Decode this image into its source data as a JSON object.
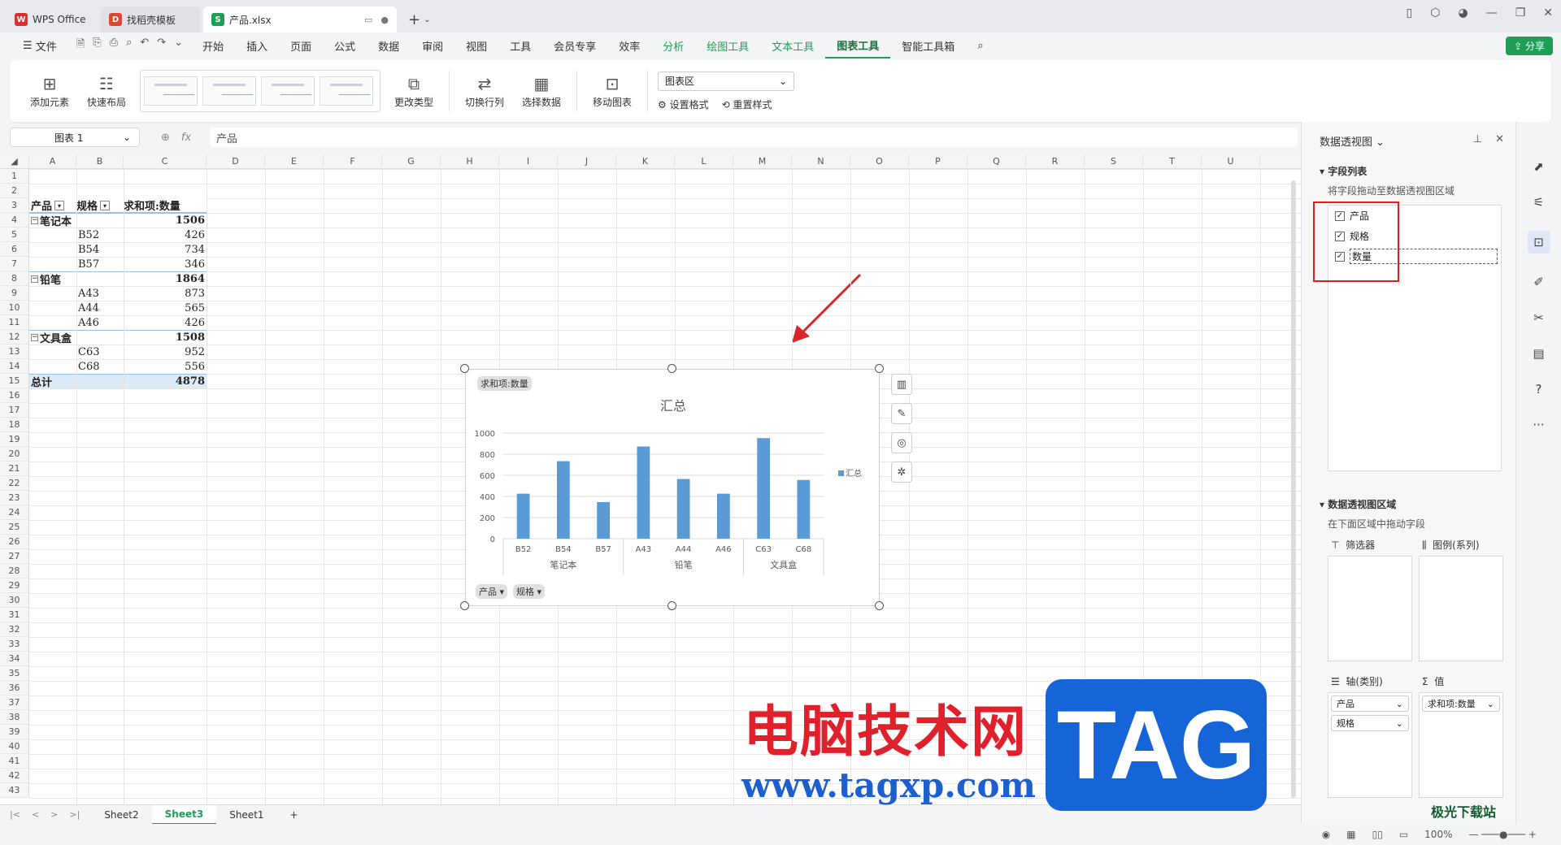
{
  "titlebar": {
    "tabs": [
      {
        "label": "WPS Office",
        "icon": "wps-logo-icon"
      },
      {
        "label": "找稻壳模板",
        "icon": "docer-icon"
      },
      {
        "label": "产品.xlsx",
        "icon": "spreadsheet-icon"
      }
    ]
  },
  "menubar": {
    "file": "文件",
    "items": [
      "开始",
      "插入",
      "页面",
      "公式",
      "数据",
      "审阅",
      "视图",
      "工具",
      "会员专享",
      "效率"
    ],
    "context_items": [
      "分析",
      "绘图工具",
      "文本工具",
      "图表工具"
    ],
    "smart": "智能工具箱",
    "share": "分享"
  },
  "ribbon": {
    "add_element": "添加元素",
    "quick_layout": "快速布局",
    "change_type": "更改类型",
    "switch_rowcol": "切换行列",
    "select_data": "选择数据",
    "move_chart": "移动图表",
    "chart_area_select": "图表区",
    "set_format": "设置格式",
    "reset_style": "重置样式"
  },
  "formula": {
    "namebox": "图表 1",
    "fx": "fx",
    "content": "产品"
  },
  "sheet": {
    "columns": [
      "A",
      "B",
      "C",
      "D",
      "E",
      "F",
      "G",
      "H",
      "I",
      "J",
      "K",
      "L",
      "M",
      "N",
      "O",
      "P",
      "Q",
      "R",
      "S",
      "T",
      "U"
    ],
    "rows": [
      "1",
      "2",
      "3",
      "4",
      "5",
      "6",
      "7",
      "8",
      "9",
      "10",
      "11",
      "12",
      "13",
      "14",
      "15",
      "16",
      "17",
      "18",
      "19",
      "20",
      "21",
      "22",
      "23",
      "24",
      "25",
      "26",
      "27",
      "28",
      "29",
      "30",
      "31",
      "32",
      "33",
      "34",
      "35",
      "36",
      "37",
      "38",
      "39",
      "40",
      "41",
      "42",
      "43"
    ]
  },
  "pivot": {
    "header": {
      "product": "产品",
      "spec": "规格",
      "sum": "求和项:数量"
    },
    "groups": [
      {
        "name": "笔记本",
        "total": "1506",
        "items": [
          {
            "spec": "B52",
            "qty": "426"
          },
          {
            "spec": "B54",
            "qty": "734"
          },
          {
            "spec": "B57",
            "qty": "346"
          }
        ]
      },
      {
        "name": "铅笔",
        "total": "1864",
        "items": [
          {
            "spec": "A43",
            "qty": "873"
          },
          {
            "spec": "A44",
            "qty": "565"
          },
          {
            "spec": "A46",
            "qty": "426"
          }
        ]
      },
      {
        "name": "文具盒",
        "total": "1508",
        "items": [
          {
            "spec": "C63",
            "qty": "952"
          },
          {
            "spec": "C68",
            "qty": "556"
          }
        ]
      }
    ],
    "grand_total_label": "总计",
    "grand_total": "4878"
  },
  "chart_data": {
    "type": "bar",
    "title": "汇总",
    "categories": [
      "B52",
      "B54",
      "B57",
      "A43",
      "A44",
      "A46",
      "C63",
      "C68"
    ],
    "groups": [
      {
        "name": "笔记本",
        "span": 3
      },
      {
        "name": "铅笔",
        "span": 3
      },
      {
        "name": "文具盒",
        "span": 2
      }
    ],
    "series": [
      {
        "name": "汇总",
        "values": [
          426,
          734,
          346,
          873,
          565,
          426,
          952,
          556
        ],
        "color": "#5b9bd5"
      }
    ],
    "ylim": [
      0,
      1000
    ],
    "yticks": [
      0,
      200,
      400,
      600,
      800,
      1000
    ],
    "grid": true,
    "legend": "right",
    "value_field_button": "求和项:数量",
    "axis_field_buttons": [
      "产品",
      "规格"
    ]
  },
  "panel": {
    "title": "数据透视图",
    "field_list_title": "字段列表",
    "field_list_hint": "将字段拖动至数据透视图区域",
    "fields": [
      {
        "name": "产品",
        "checked": true
      },
      {
        "name": "规格",
        "checked": true
      },
      {
        "name": "数量",
        "checked": true
      }
    ],
    "areas_title": "数据透视图区域",
    "areas_hint": "在下面区域中拖动字段",
    "filter": "筛选器",
    "legend": "图例(系列)",
    "axis": "轴(类别)",
    "values": "值",
    "axis_items": [
      "产品",
      "规格"
    ],
    "value_items": [
      "求和项:数量"
    ]
  },
  "sheettabs": [
    "Sheet2",
    "Sheet3",
    "Sheet1"
  ],
  "status": {
    "zoom": "100%"
  },
  "watermark": {
    "cn": "电脑技术网",
    "url": "www.tagxp.com",
    "tag": "TAG",
    "corner": "极光下载站"
  },
  "colors": {
    "accent": "#1f9e58",
    "bar": "#5b9bd5",
    "highlight": "#e01e1e"
  }
}
